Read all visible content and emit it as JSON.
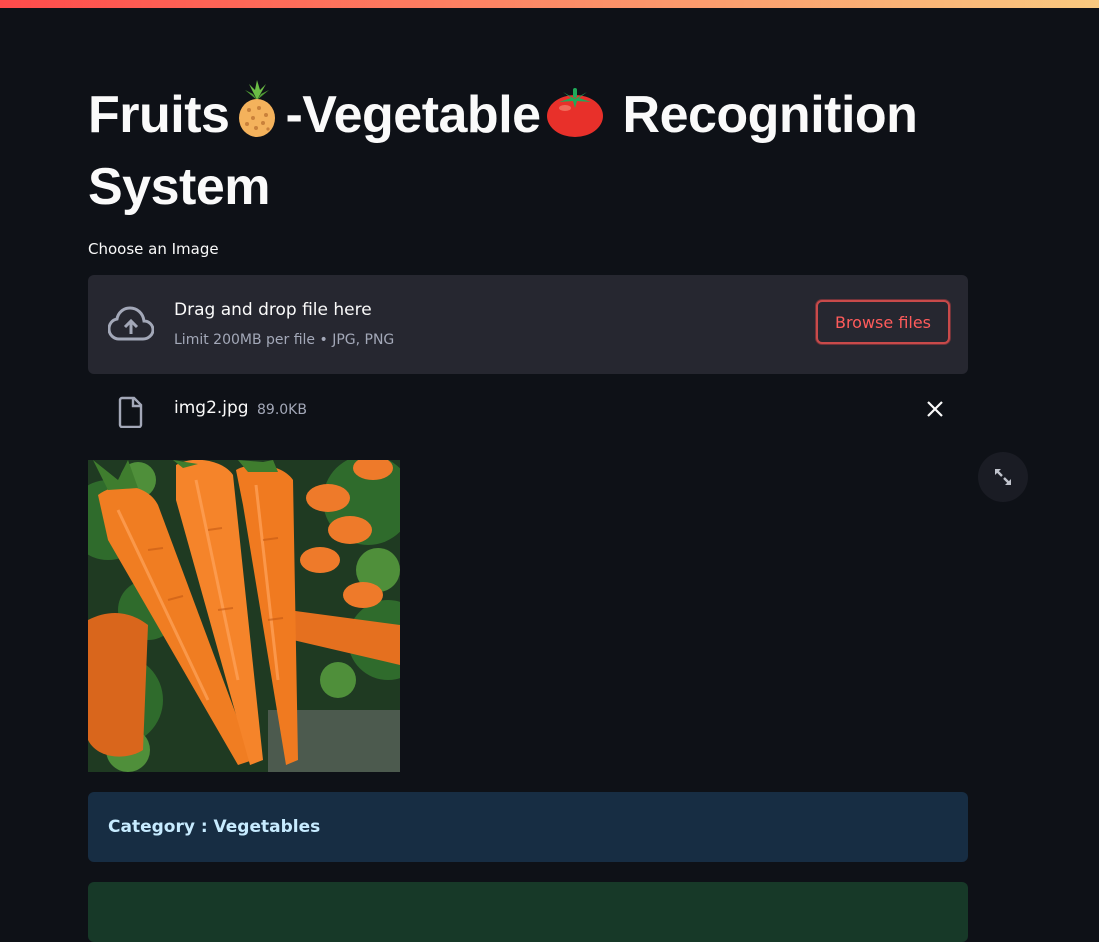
{
  "header": {
    "title_part1": "Fruits",
    "title_part2": "-Vegetable",
    "title_part3": "Recognition System",
    "emoji_1": "pineapple-emoji",
    "emoji_2": "tomato-emoji"
  },
  "uploader": {
    "label": "Choose an Image",
    "drag_text": "Drag and drop file here",
    "limit_text": "Limit 200MB per file • JPG, PNG",
    "browse_label": "Browse files",
    "icon": "cloud-upload-icon"
  },
  "uploaded_file": {
    "name": "img2.jpg",
    "size": "89.0KB",
    "icon": "file-icon",
    "remove_icon": "close-icon"
  },
  "image": {
    "subject": "carrots",
    "fullscreen_icon": "expand-icon"
  },
  "result": {
    "category": "Category : Vegetables"
  },
  "colors": {
    "background": "#0e1117",
    "accent": "#ff4b4b",
    "info_bg": "#172d43",
    "success_bg": "#173928"
  }
}
